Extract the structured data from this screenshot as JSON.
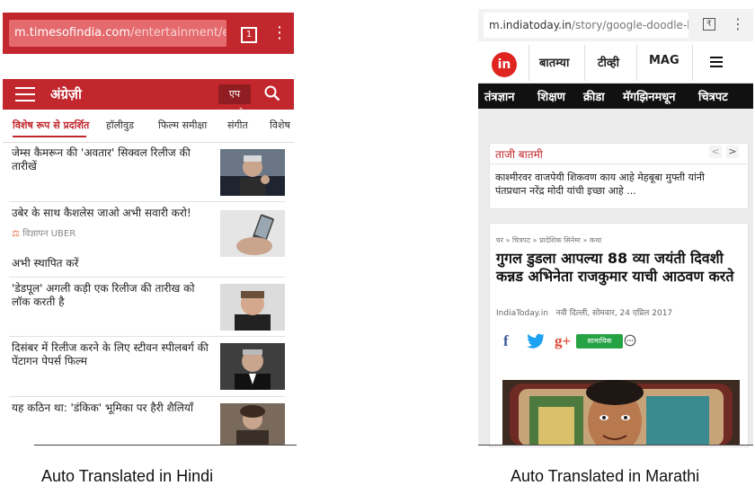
{
  "left": {
    "url": {
      "host": "m.timesofindia.com",
      "path": "/entertainment/engli"
    },
    "tab_count": "1",
    "section_title": "अंग्रेज़ी",
    "search_button": "एप पाओ",
    "tabs": [
      "विशेष रूप से प्रदर्शित",
      "हॉलीवुड",
      "फिल्म समीक्षा",
      "संगीत",
      "विशेष"
    ],
    "articles": [
      {
        "title": "जेम्स कैमरून की 'अवतार' सिक्वल रिलीज की तारीखें"
      },
      {
        "title": "उबेर के साथ कैशलेस जाओ अभी सवारी करो!",
        "ad_label": "विज्ञापन UBER",
        "ad_cta": "अभी स्थापित करें"
      },
      {
        "title": "'डेडपूल' अगली कड़ी एक रिलीज की तारीख को लॉक करती है"
      },
      {
        "title": "दिसंबर में रिलीज करने के लिए स्टीवन स्पीलबर्ग की पेंटागन पेपर्स फिल्म"
      },
      {
        "title": "यह कठिन था: 'डंकिक' भूमिका पर हैरी शैलियाँ"
      }
    ],
    "caption": "Auto Translated in Hindi",
    "accent_color": "#c1272d"
  },
  "right": {
    "url": {
      "host": "m.indiatoday.in",
      "path": "/story/google-doodle-kan"
    },
    "logo": "in",
    "nav": [
      "बातम्या",
      "टीव्ही",
      "MAG"
    ],
    "categories": [
      "तंत्रज्ञान",
      "शिक्षण",
      "क्रीडा",
      "मॅगझिनमधून",
      "चित्रपट"
    ],
    "breaking": {
      "title": "ताजी बातमी",
      "text": "काश्मीरवर वाजपेयी शिकवण काय आहे मेहबूबा मुफ्ती यांनी पंतप्रधान नरेंद्र मोदी यांची इच्छा आहे ..."
    },
    "breadcrumbs": "घर » चित्रपट » प्रादेशिक सिनेमा » कथा",
    "headline": "गुगल डुडला आपल्या 88 व्या जयंती दिवशी कन्नड अभिनेता राजकुमार याची आठवण करते",
    "source": "IndiaToday.in",
    "dateline": "नवी दिल्ली, सोमवार, 24 एप्रिल 2017",
    "share": {
      "facebook": "f",
      "twitter": "twitter-icon",
      "gplus": "g+",
      "whatsapp": "सामायिक"
    },
    "caption": "Auto Translated in Marathi",
    "logo_color": "#e0241f"
  }
}
